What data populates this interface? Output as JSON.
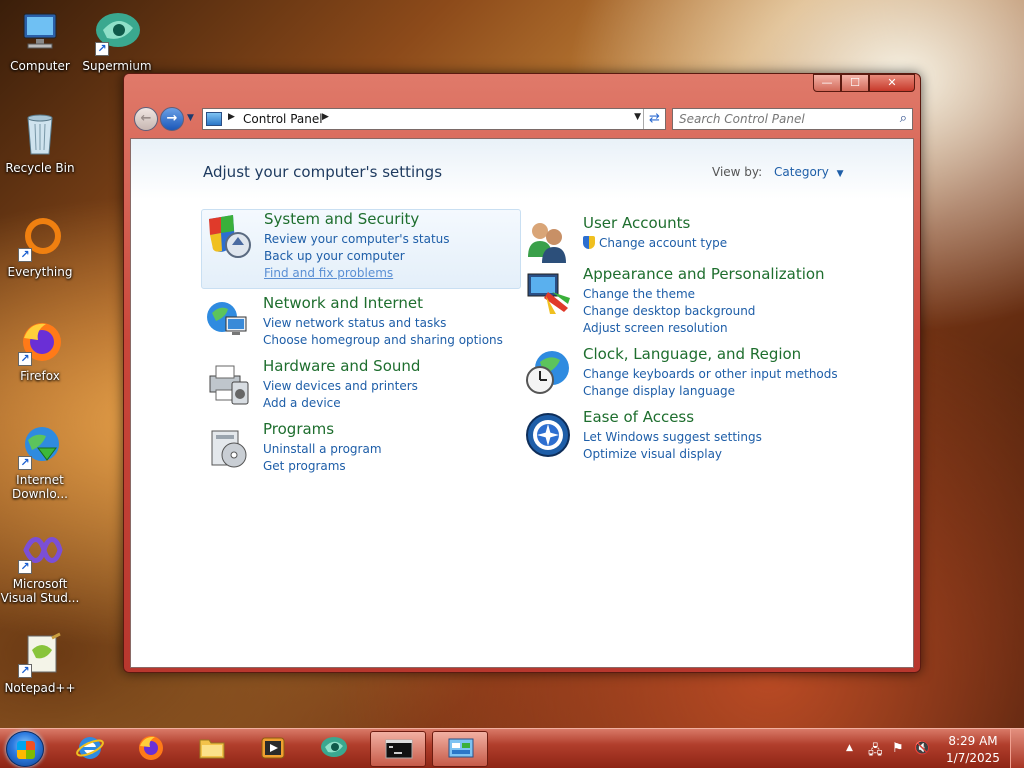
{
  "desktop": {
    "icons": [
      {
        "label": "Computer"
      },
      {
        "label": "Supermium"
      },
      {
        "label": "Recycle Bin"
      },
      {
        "label": "Everything"
      },
      {
        "label": "Firefox"
      },
      {
        "label": "Internet Downlo..."
      },
      {
        "label": "Microsoft Visual Stud..."
      },
      {
        "label": "Notepad++"
      }
    ]
  },
  "window": {
    "controls": {
      "minimize": "—",
      "maximize": "☐",
      "close": "✕"
    },
    "address": {
      "crumb": "Control Panel",
      "separator": "▶"
    },
    "search": {
      "placeholder": "Search Control Panel"
    },
    "page_title": "Adjust your computer's settings",
    "view_by": {
      "label": "View by:",
      "value": "Category"
    },
    "categories": [
      {
        "title": "System and Security",
        "links": [
          "Review your computer's status",
          "Back up your computer",
          "Find and fix problems"
        ]
      },
      {
        "title": "Network and Internet",
        "links": [
          "View network status and tasks",
          "Choose homegroup and sharing options"
        ]
      },
      {
        "title": "Hardware and Sound",
        "links": [
          "View devices and printers",
          "Add a device"
        ]
      },
      {
        "title": "Programs",
        "links": [
          "Uninstall a program",
          "Get programs"
        ]
      },
      {
        "title": "User Accounts",
        "links": [
          "Change account type"
        ]
      },
      {
        "title": "Appearance and Personalization",
        "links": [
          "Change the theme",
          "Change desktop background",
          "Adjust screen resolution"
        ]
      },
      {
        "title": "Clock, Language, and Region",
        "links": [
          "Change keyboards or other input methods",
          "Change display language"
        ]
      },
      {
        "title": "Ease of Access",
        "links": [
          "Let Windows suggest settings",
          "Optimize visual display"
        ]
      }
    ]
  },
  "taskbar": {
    "clock": {
      "time": "8:29 AM",
      "date": "1/7/2025"
    },
    "tray_arrow": "▲"
  },
  "colors": {
    "category_title": "#1e6e2e",
    "link": "#1e5ea8",
    "window_frame": "#c9463a"
  }
}
